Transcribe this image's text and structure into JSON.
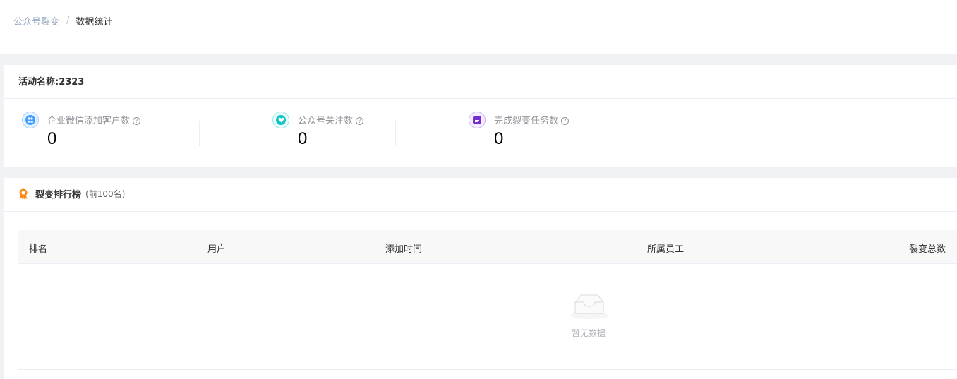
{
  "breadcrumb": {
    "parent": "公众号裂变",
    "separator": "/",
    "current": "数据统计"
  },
  "activity": {
    "title": "活动名称:2323"
  },
  "stats": [
    {
      "label": "企业微信添加客户数",
      "value": "0",
      "icon": "users-icon",
      "color": "#409eff"
    },
    {
      "label": "公众号关注数",
      "value": "0",
      "icon": "heart-icon",
      "color": "#13c2c2"
    },
    {
      "label": "完成裂变任务数",
      "value": "0",
      "icon": "task-icon",
      "color": "#722ed1"
    }
  ],
  "ranking": {
    "title": "裂变排行榜",
    "subtitle": "(前100名)",
    "accent": "#fa8c16",
    "columns": [
      "排名",
      "用户",
      "添加时间",
      "所属员工",
      "裂变总数"
    ],
    "empty_text": "暂无数据"
  }
}
